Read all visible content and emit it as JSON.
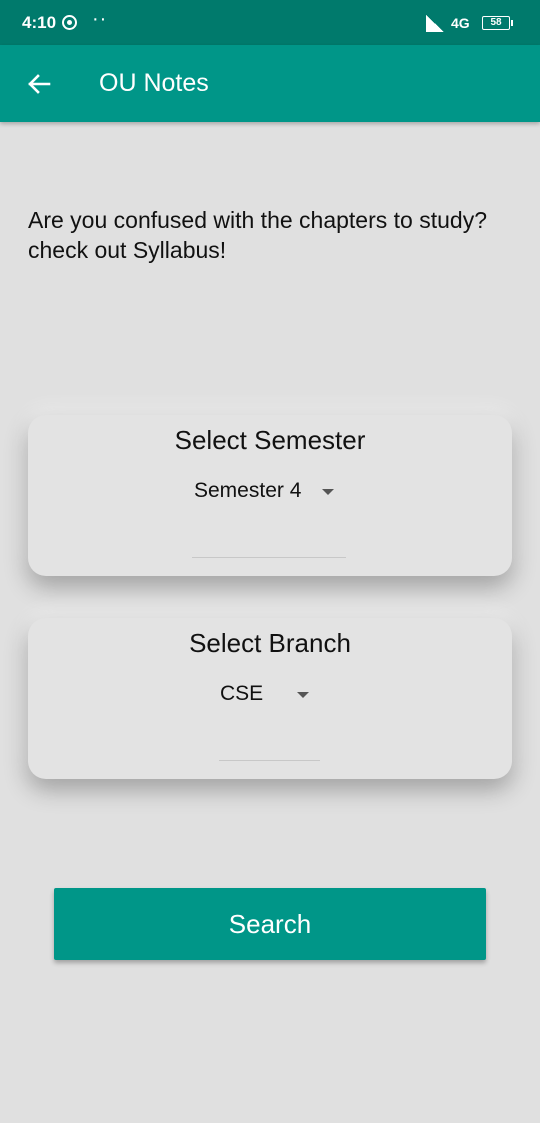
{
  "status_bar": {
    "time": "4:10",
    "dots": "··",
    "network": "4G",
    "battery": "58"
  },
  "app_bar": {
    "title": "OU Notes",
    "back_icon": "arrow-back-icon",
    "color": "#009688"
  },
  "intro": {
    "text": "Are you confused with the chapters to study?check out Syllabus!"
  },
  "semester_card": {
    "title": "Select Semester",
    "selected": "Semester 4"
  },
  "branch_card": {
    "title": "Select Branch",
    "selected": "CSE"
  },
  "search_button": {
    "label": "Search"
  },
  "colors": {
    "accent": "#009688",
    "status_bar": "#007a6c",
    "background": "#e0e0e0"
  }
}
